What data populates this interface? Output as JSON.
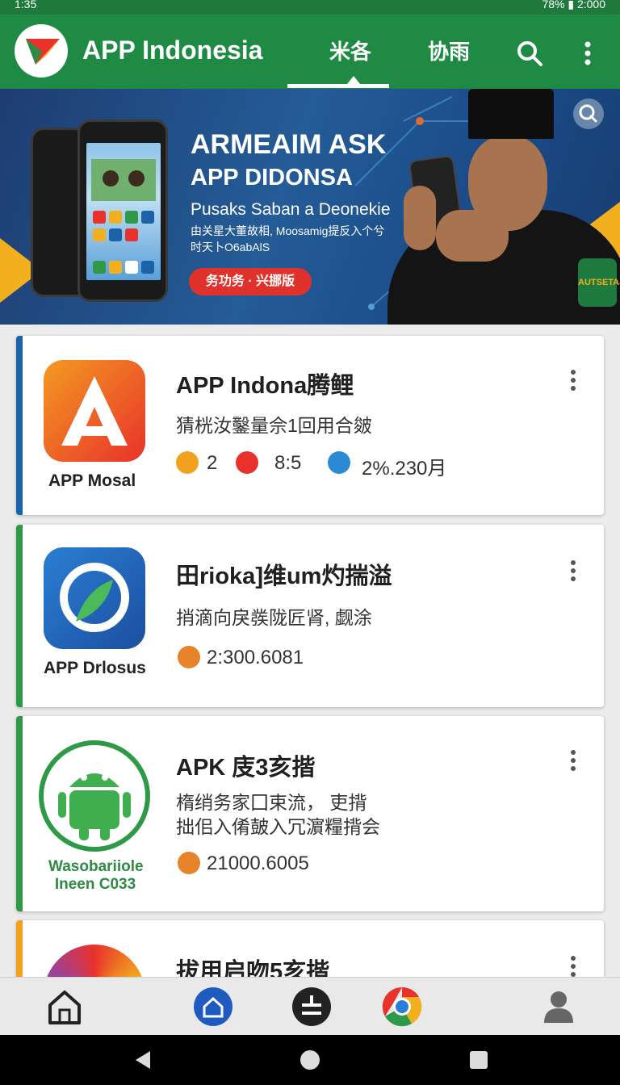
{
  "status_bar": {
    "time": "1:35",
    "right": "78% ▮ 2:000"
  },
  "app_bar": {
    "title": "APP Indonesia",
    "tabs": [
      "米各",
      "协雨"
    ],
    "active_tab": 0
  },
  "banner": {
    "headline": "ARMEAIM ASK",
    "subheadline": "APP DIDONSA",
    "tagline": "Pusaks Saban a Deonekie",
    "body_lines": [
      "由关星大董故相, Moosamig提反入个兮",
      "时天卜O6abAlS"
    ],
    "cta_label": "务功务 · 兴挪版",
    "badge_text": "AUTSETAJ"
  },
  "apps": [
    {
      "name": "APP Indona腾鲤",
      "label": "APP Mosal",
      "description": "猜桄汝鑿量佘1回用合皴",
      "stats": [
        "2",
        "8:5",
        "2%.230月"
      ],
      "accent": "#1c62a8",
      "icon": "a-letter-icon"
    },
    {
      "name": "田rioka]维um灼揣溢",
      "label": "APP Drlosus",
      "description": "捎滴向戾彂陇匠肾, 觑涂",
      "stats": [
        "2:300.6081"
      ],
      "accent": "#2e9a48",
      "icon": "chat-bubble-icon"
    },
    {
      "name": "APK 庋3亥揩",
      "label": "Wasobariiole Ineen C033",
      "description_lines": [
        "楕绡务家囗束流， 吏揹",
        "拙佀入倄皷入冗濵糧揹会"
      ],
      "stats": [
        "21000.6005"
      ],
      "accent": "#2e9a48",
      "icon": "android-icon"
    },
    {
      "name": "拔用启吻5亥揩",
      "accent": "#f2a21e",
      "icon": "colorful-circle-icon"
    }
  ],
  "bottom_nav": [
    "home-icon",
    "house-circle-icon",
    "plus-minus-icon",
    "chrome-icon",
    "profile-icon"
  ],
  "colors": {
    "primary": "#1f8a43",
    "banner": "#245c97",
    "cta": "#e0312b",
    "yellow": "#f2b01e"
  }
}
